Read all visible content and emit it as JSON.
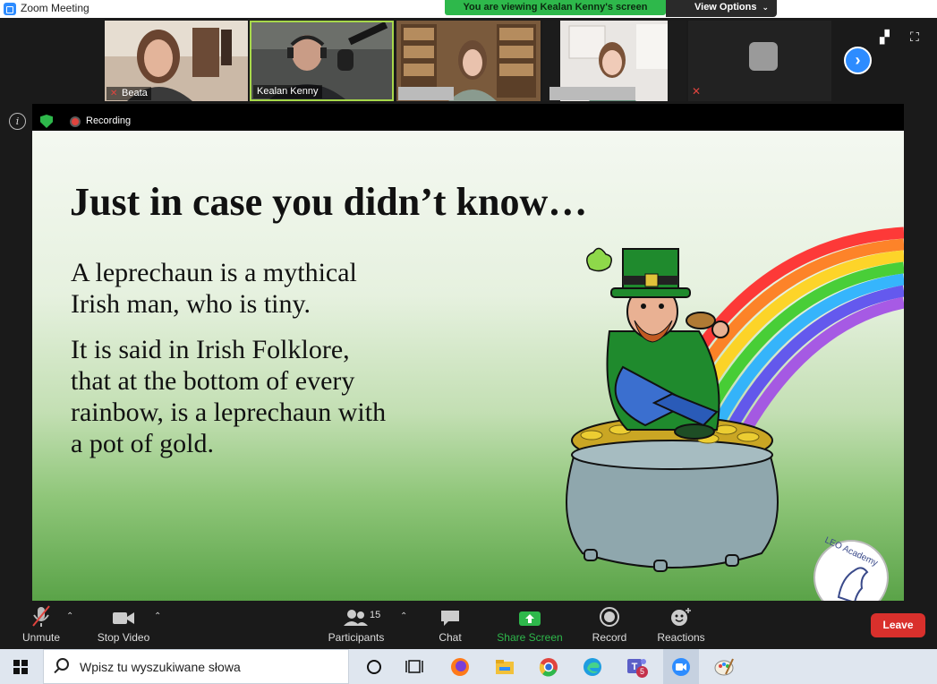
{
  "window": {
    "title": "Zoom Meeting"
  },
  "banner": {
    "viewing": "You are viewing Kealan Kenny's screen",
    "view_options": "View Options"
  },
  "participants_strip": [
    {
      "name": "Beata",
      "muted": true
    },
    {
      "name": "Kealan Kenny",
      "muted": false,
      "active": true
    },
    {
      "name": "",
      "muted": false
    },
    {
      "name": "",
      "muted": false
    },
    {
      "name": "",
      "muted": true
    }
  ],
  "recording": {
    "label": "Recording"
  },
  "slide": {
    "title": "Just in case you didn’t know…",
    "paragraph1": [
      "A leprechaun is a mythical",
      "Irish man, who is tiny."
    ],
    "paragraph2": [
      "It is said in Irish Folklore,",
      "that at the bottom of every",
      "rainbow, is a leprechaun with",
      "a pot of gold."
    ],
    "logo_text": "LEO Academy"
  },
  "toolbar": {
    "unmute": "Unmute",
    "stop_video": "Stop Video",
    "participants": "Participants",
    "participants_count": "15",
    "chat": "Chat",
    "share_screen": "Share Screen",
    "record": "Record",
    "reactions": "Reactions",
    "leave": "Leave"
  },
  "taskbar": {
    "search_placeholder": "Wpisz tu wyszukiwane słowa",
    "teams_badge": "5"
  },
  "colors": {
    "accent_green": "#2eb84b",
    "zoom_blue": "#2d8cff",
    "leave_red": "#d9302c"
  }
}
